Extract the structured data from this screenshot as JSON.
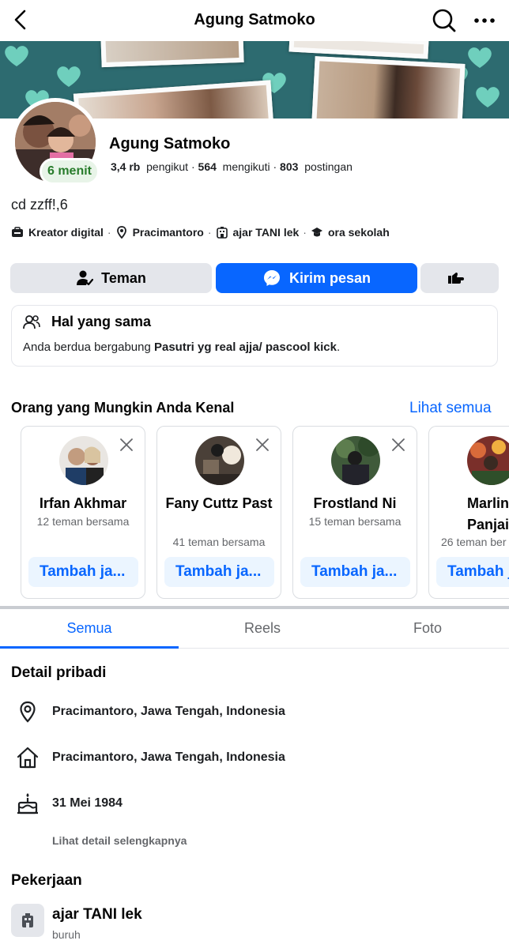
{
  "header": {
    "title": "Agung Satmoko"
  },
  "profile": {
    "name": "Agung Satmoko",
    "active_badge": "6 menit",
    "followers_count": "3,4 rb",
    "followers_label": "pengikut",
    "following_count": "564",
    "following_label": "mengikuti",
    "posts_count": "803",
    "posts_label": "postingan",
    "bio": "cd zzff!,6",
    "intro": {
      "category": "Kreator digital",
      "location": "Pracimantoro",
      "work": "ajar TANI lek",
      "education": "ora sekolah"
    }
  },
  "actions": {
    "friends": "Teman",
    "message": "Kirim pesan"
  },
  "mutual": {
    "title": "Hal yang sama",
    "text_prefix": "Anda berdua bergabung ",
    "group": "Pasutri yg real ajja/ pascool kick",
    "text_suffix": "."
  },
  "pymk": {
    "title": "Orang yang Mungkin Anda Kenal",
    "see_all": "Lihat semua",
    "people": [
      {
        "name": "Irfan Akhmar",
        "mutual": "12 teman bersama",
        "add": "Tambah ja..."
      },
      {
        "name": "Fany Cuttz Past",
        "mutual": "41 teman bersama",
        "add": "Tambah ja..."
      },
      {
        "name": "Frostland Ni",
        "mutual": "15 teman bersama",
        "add": "Tambah ja..."
      },
      {
        "name": "Marlin Panjaita",
        "mutual": "26 teman ber",
        "add": "Tambah j"
      }
    ]
  },
  "tabs": [
    "Semua",
    "Reels",
    "Foto"
  ],
  "details": {
    "title": "Detail pribadi",
    "current_city": "Pracimantoro, Jawa Tengah, Indonesia",
    "hometown": "Pracimantoro, Jawa Tengah, Indonesia",
    "birthday": "31 Mei 1984",
    "see_more": "Lihat detail selengkapnya"
  },
  "work": {
    "title": "Pekerjaan",
    "employer": "ajar TANI lek",
    "role": "buruh"
  },
  "colors": {
    "accent": "#0866ff",
    "active_green": "#287c2b",
    "cover_teal": "#2d6b70"
  }
}
